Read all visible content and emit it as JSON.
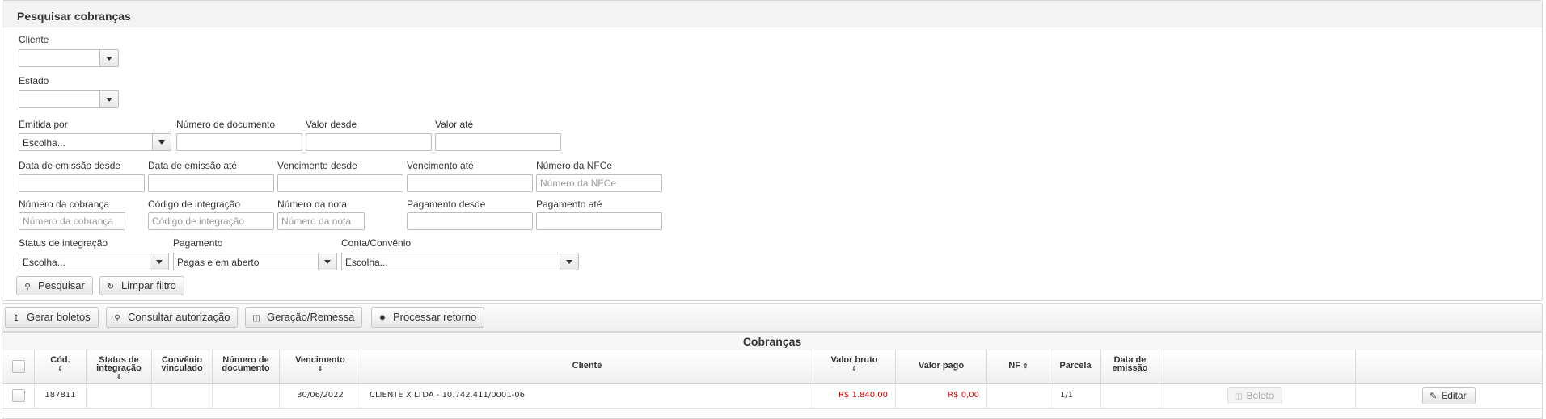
{
  "panel": {
    "title": "Pesquisar cobranças"
  },
  "filters": {
    "cliente": {
      "label": "Cliente",
      "value": ""
    },
    "estado": {
      "label": "Estado",
      "value": ""
    },
    "emitida_por": {
      "label": "Emitida por",
      "value": "Escolha..."
    },
    "numero_documento": {
      "label": "Número de documento",
      "value": ""
    },
    "valor_desde": {
      "label": "Valor desde",
      "value": ""
    },
    "valor_ate": {
      "label": "Valor até",
      "value": ""
    },
    "data_emissao_desde": {
      "label": "Data de emissão desde",
      "value": ""
    },
    "data_emissao_ate": {
      "label": "Data de emissão até",
      "value": ""
    },
    "vencimento_desde": {
      "label": "Vencimento desde",
      "value": ""
    },
    "vencimento_ate": {
      "label": "Vencimento até",
      "value": ""
    },
    "numero_nfce": {
      "label": "Número da NFCe",
      "placeholder": "Número da NFCe"
    },
    "numero_cobranca": {
      "label": "Número da cobrança",
      "placeholder": "Número da cobrança"
    },
    "codigo_integracao": {
      "label": "Código de integração",
      "placeholder": "Código de integração"
    },
    "numero_nota": {
      "label": "Número da nota",
      "placeholder": "Número da nota"
    },
    "pagamento_desde": {
      "label": "Pagamento desde",
      "value": ""
    },
    "pagamento_ate": {
      "label": "Pagamento até",
      "value": ""
    },
    "status_integracao": {
      "label": "Status de integração",
      "value": "Escolha..."
    },
    "pagamento": {
      "label": "Pagamento",
      "value": "Pagas e em aberto"
    },
    "conta_convenio": {
      "label": "Conta/Convênio",
      "value": "Escolha..."
    }
  },
  "actions": {
    "pesquisar": "Pesquisar",
    "limpar_filtro": "Limpar filtro"
  },
  "toolbar": {
    "gerar_boletos": "Gerar boletos",
    "consultar_autorizacao": "Consultar autorização",
    "geracao_remessa": "Geração/Remessa",
    "processar_retorno": "Processar retorno"
  },
  "table": {
    "caption": "Cobranças",
    "columns": {
      "cod": "Cód.",
      "status_l1": "Status de",
      "status_l2": "integração",
      "convenio_l1": "Convênio",
      "convenio_l2": "vinculado",
      "numero_l1": "Número de",
      "numero_l2": "documento",
      "vencimento": "Vencimento",
      "cliente": "Cliente",
      "valor_bruto": "Valor bruto",
      "valor_pago": "Valor pago",
      "nf": "NF",
      "parcela": "Parcela",
      "data_l1": "Data de",
      "data_l2": "emissão"
    },
    "rows": [
      {
        "cod": "187811",
        "status_integracao": "",
        "convenio": "",
        "numero_documento": "",
        "vencimento": "30/06/2022",
        "cliente": "CLIENTE X LTDA - 10.742.411/0001-06",
        "valor_bruto": "R$ 1.840,00",
        "valor_pago": "R$ 0,00",
        "nf": "",
        "parcela": "1/1",
        "data_emissao": "",
        "boleto_label": "Boleto",
        "editar_label": "Editar"
      }
    ]
  },
  "colors": {
    "negative_value": "#e00000",
    "panel_header": "#f3f3f3"
  }
}
